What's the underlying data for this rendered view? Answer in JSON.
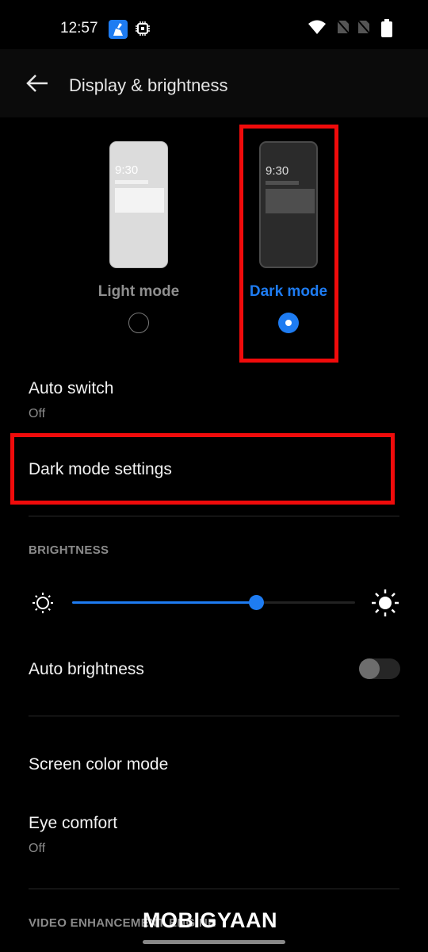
{
  "status_bar": {
    "time": "12:57",
    "icons": [
      "cleaner-app-icon",
      "chip-icon",
      "wifi-icon",
      "no-sim-icon",
      "no-sim-icon",
      "battery-icon"
    ]
  },
  "app_bar": {
    "back_icon": "arrow-left-icon",
    "title": "Display & brightness"
  },
  "theme_modes": {
    "preview_time": "9:30",
    "options": [
      {
        "label": "Light mode",
        "selected": false
      },
      {
        "label": "Dark mode",
        "selected": true
      }
    ]
  },
  "settings": {
    "auto_switch": {
      "title": "Auto switch",
      "value": "Off"
    },
    "dark_mode_settings": {
      "title": "Dark mode settings"
    },
    "brightness_header": "BRIGHTNESS",
    "brightness": {
      "level_percent": 65,
      "min_icon": "sun-outline-icon",
      "max_icon": "sun-filled-icon"
    },
    "auto_brightness": {
      "title": "Auto brightness",
      "enabled": false
    },
    "screen_color_mode": {
      "title": "Screen color mode"
    },
    "eye_comfort": {
      "title": "Eye comfort",
      "value": "Off"
    },
    "video_header": "VIDEO ENHANCEMENT ENGINE"
  },
  "watermark": "MOBIGYAAN",
  "colors": {
    "accent": "#1e7cf2",
    "highlight": "#f00b0b",
    "background": "#000000"
  }
}
